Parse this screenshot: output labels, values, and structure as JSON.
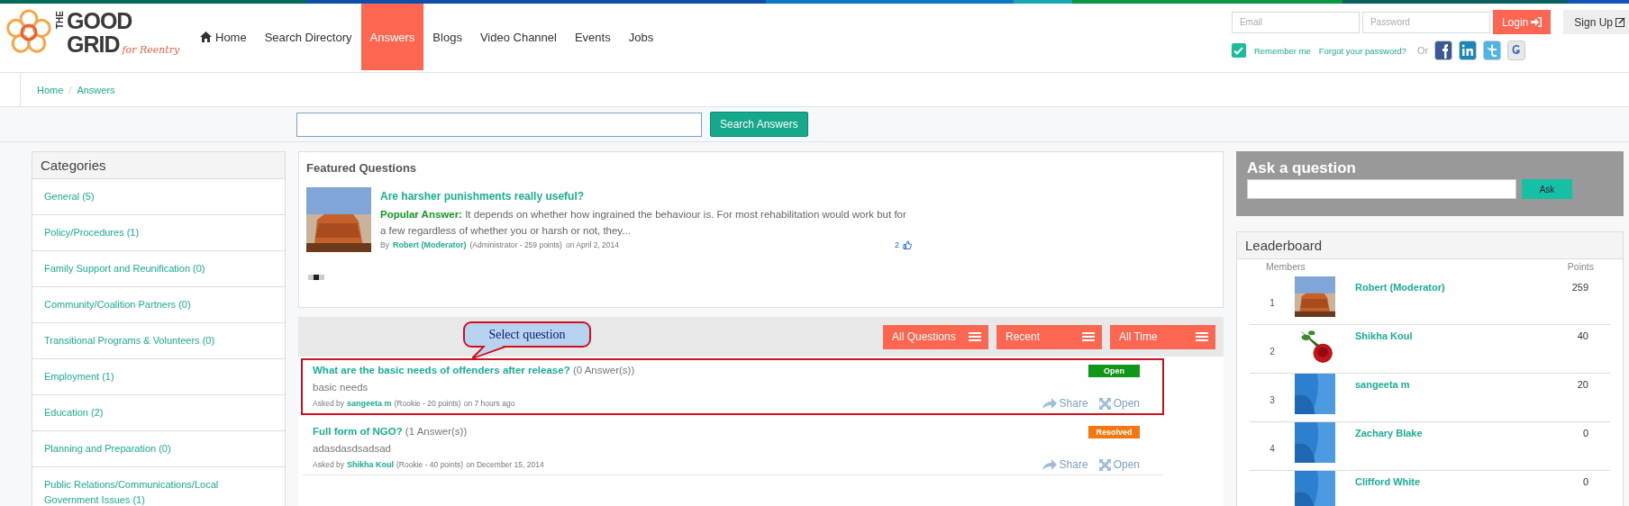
{
  "logo": {
    "line_1": "THE",
    "line_2": "GOOD",
    "line_3": "GRID",
    "tagline": "for Reentry"
  },
  "nav": [
    {
      "label": "Home",
      "selected": false
    },
    {
      "label": "Search Directory",
      "selected": false
    },
    {
      "label": "Answers",
      "selected": true
    },
    {
      "label": "Blogs",
      "selected": false
    },
    {
      "label": "Video Channel",
      "selected": false
    },
    {
      "label": "Events",
      "selected": false
    },
    {
      "label": "Jobs",
      "selected": false
    }
  ],
  "login": {
    "email_placeholder": "Email",
    "password_placeholder": "Password",
    "login_button": "Login",
    "signup_button": "Sign Up",
    "remember": {
      "label": "Remember me",
      "checked": true
    },
    "forgot": "Forgot your password?",
    "or": "Or"
  },
  "breadcrumb": [
    "Home",
    "Answers"
  ],
  "breadcrumb_separator": "/",
  "search": {
    "button": "Search Answers"
  },
  "categories": {
    "title": "Categories",
    "items": [
      "General (5)",
      "Policy/Procedures (1)",
      "Family Support and Reunification (0)",
      "Community/Coalition Partners (0)",
      "Transitional Programs & Volunteers (0)",
      "Employment (1)",
      "Education (2)",
      "Planning and Preparation (0)",
      "Public Relations/Communications/Local Government Issues (1)"
    ]
  },
  "featured": {
    "title": "Featured Questions",
    "question": "Are harsher punishments really useful?",
    "answer_label": "Popular Answer:",
    "answer": "It depends on whether how ingrained the behaviour is. For most rehabilitation would work but for a few regardless of whether you or harsh or not, they...",
    "by": "By",
    "author": "Robert (Moderator)",
    "author_info": "(Administrator - 259 points)",
    "date": "on April 2, 2014",
    "likes": "2",
    "dots": [
      {
        "selected": false
      },
      {
        "selected": true
      },
      {
        "selected": false
      }
    ]
  },
  "filters": [
    "All Questions",
    "Recent",
    "All Time"
  ],
  "callout": "Select question",
  "questions": [
    {
      "title": "What are the basic needs of offenders after release?",
      "answers": "(0 Answer(s))",
      "body": "basic needs",
      "asked_by": "Asked by",
      "author": "sangeeta m",
      "author_info": "(Rookie - 20 points)",
      "time": "on 7 hours ago",
      "status": "Open",
      "color": "#109618",
      "highlighted": true,
      "share": "Share",
      "open": "Open"
    },
    {
      "title": "Full form of NGO?",
      "answers": "(1 Answer(s))",
      "body": "adasdasdsadsad",
      "asked_by": "Asked by",
      "author": "Shikha Koul",
      "author_info": "(Rookie - 40 points)",
      "time": "on December 15, 2014",
      "status": "Resolved",
      "color": "#f4780f",
      "highlighted": false,
      "share": "Share",
      "open": "Open"
    }
  ],
  "ask": {
    "title": "Ask a question",
    "button": "Ask"
  },
  "leaderboard": {
    "title": "Leaderboard",
    "members_header": "Members",
    "points_header": "Points",
    "rows": [
      {
        "rank": "1",
        "name": "Robert (Moderator)",
        "points": "259"
      },
      {
        "rank": "2",
        "name": "Shikha Koul",
        "points": "40"
      },
      {
        "rank": "3",
        "name": "sangeeta m",
        "points": "20"
      },
      {
        "rank": "4",
        "name": "Zachary Blake",
        "points": "0"
      },
      {
        "name": "Clifford White",
        "points": "0"
      }
    ]
  }
}
